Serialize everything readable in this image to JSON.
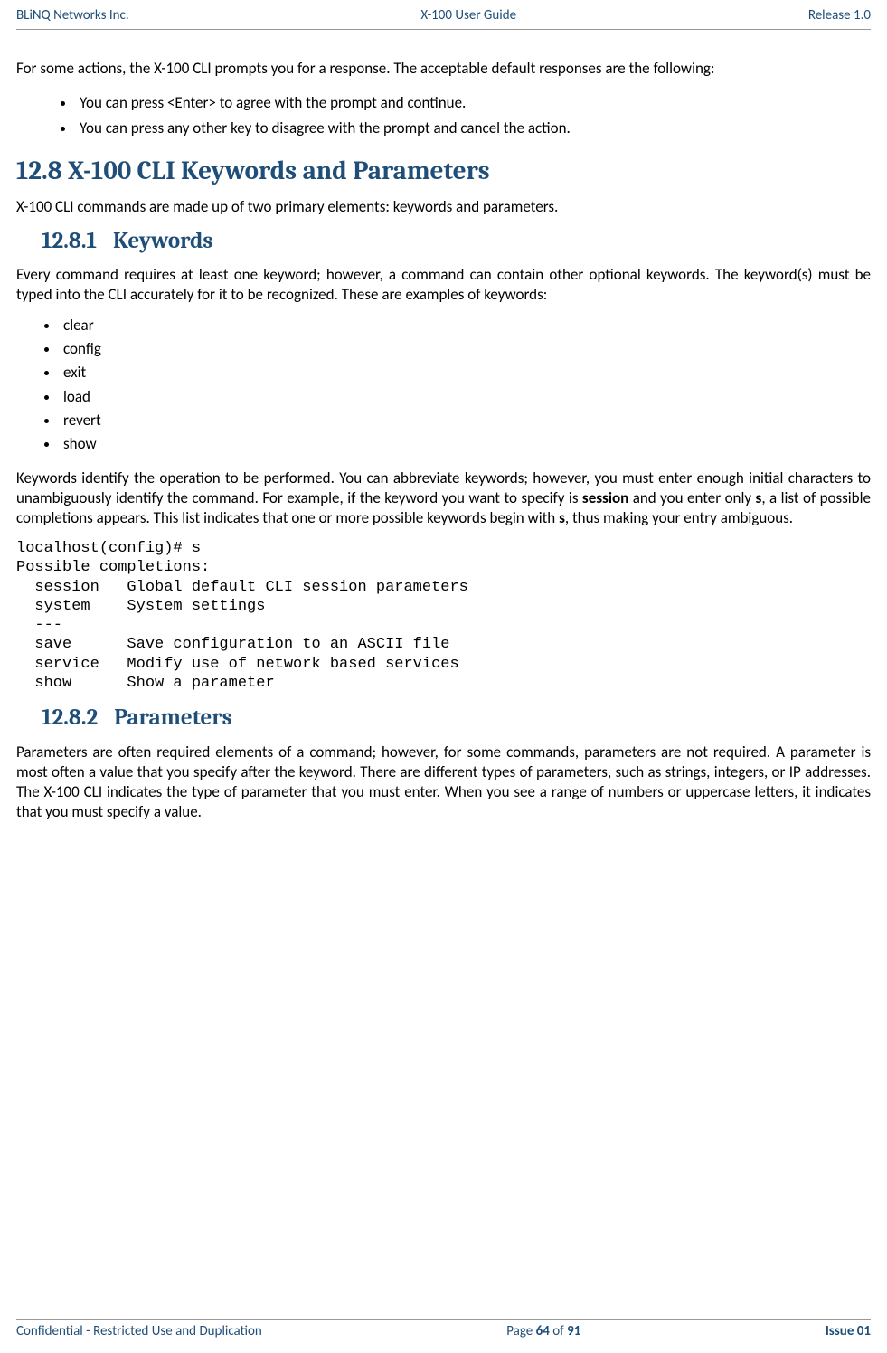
{
  "header": {
    "left": "BLiNQ Networks Inc.",
    "center": "X-100 User Guide",
    "right": "Release 1.0"
  },
  "intro_para": "For some actions, the X-100 CLI prompts you for a response. The acceptable default responses are the following:",
  "intro_bullets": [
    "You can press <Enter> to agree with the prompt and continue.",
    "You can press any other key to disagree with the prompt and cancel the action."
  ],
  "sec12_8": {
    "title": "12.8 X-100 CLI Keywords and Parameters",
    "lead": "X-100 CLI commands are made up of two primary elements: keywords and parameters."
  },
  "sec12_8_1": {
    "num": "12.8.1",
    "title": "Keywords",
    "para1": "Every command requires at least one keyword; however, a command can contain other optional keywords. The keyword(s) must be typed into the CLI accurately for it to be recognized. These are examples of keywords:",
    "keywords": [
      "clear",
      "config",
      "exit",
      "load",
      "revert",
      "show"
    ],
    "para2_parts": {
      "a": "Keywords identify the operation to be performed. You can abbreviate keywords; however, you must enter enough initial characters to unambiguously identify the command. For example, if the keyword you want to specify is ",
      "b_bold": "session",
      "c": " and you enter only ",
      "d_bold": "s",
      "e": ", a list of possible completions appears. This list indicates that one or more possible keywords begin with ",
      "f_bold": "s",
      "g": ", thus making your entry ambiguous."
    },
    "cli": "localhost(config)# s\nPossible completions:\n  session   Global default CLI session parameters\n  system    System settings\n  ---\n  save      Save configuration to an ASCII file\n  service   Modify use of network based services\n  show      Show a parameter"
  },
  "sec12_8_2": {
    "num": "12.8.2",
    "title": "Parameters",
    "para": "Parameters are often required elements of a command; however, for some commands, parameters are not required. A parameter is most often a value that you specify after the keyword. There are different types of parameters, such as strings, integers, or IP addresses. The X-100 CLI indicates the type of parameter that you must enter. When you see a range of numbers or uppercase letters, it indicates that you must specify a value."
  },
  "footer": {
    "left": "Confidential - Restricted Use and Duplication",
    "page_prefix": "Page ",
    "page_cur": "64",
    "page_of": " of ",
    "page_total": "91",
    "right": "Issue 01"
  }
}
